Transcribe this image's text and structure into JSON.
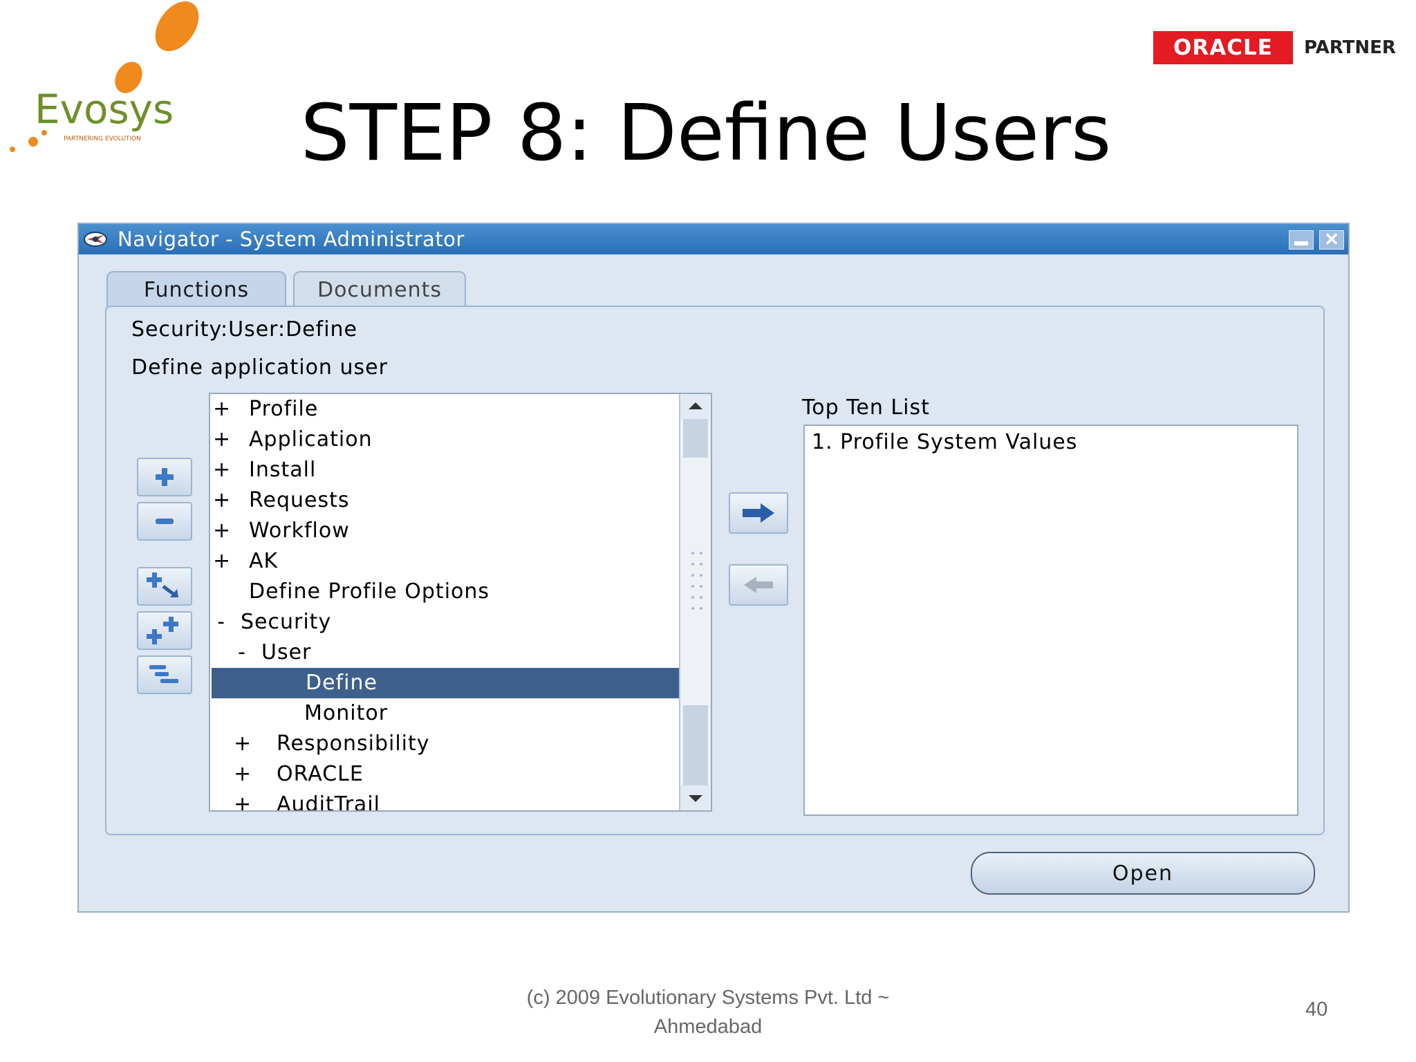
{
  "slide": {
    "title": "STEP 8: Define Users",
    "footer_line1": "(c) 2009 Evolutionary Systems Pvt. Ltd ~",
    "footer_line2": "Ahmedabad",
    "page_number": "40"
  },
  "logos": {
    "evosys_text": "Evosys",
    "evosys_tagline": "PARTNERING EVOLUTION",
    "oracle_text": "ORACLE",
    "partner_text": "PARTNER"
  },
  "window": {
    "title": "Navigator - System Administrator",
    "tabs": [
      {
        "label": "Functions",
        "active": true
      },
      {
        "label": "Documents",
        "active": false
      }
    ],
    "path_label": "Security:User:Define",
    "description": "Define application user",
    "tree_items": [
      {
        "marker": "+",
        "label": "Profile",
        "level": 0
      },
      {
        "marker": "+",
        "label": "Application",
        "level": 0
      },
      {
        "marker": "+",
        "label": "Install",
        "level": 0
      },
      {
        "marker": "+",
        "label": "Requests",
        "level": 0
      },
      {
        "marker": "+",
        "label": "Workflow",
        "level": 0
      },
      {
        "marker": "+",
        "label": "AK",
        "level": 0
      },
      {
        "marker": "",
        "label": "Define Profile Options",
        "level": 0
      },
      {
        "marker": "-",
        "label": "Security",
        "level": 0
      },
      {
        "marker": "-",
        "label": "User",
        "level": 1
      },
      {
        "marker": "",
        "label": "Define",
        "level": 2,
        "selected": true
      },
      {
        "marker": "",
        "label": "Monitor",
        "level": 2
      },
      {
        "marker": "+",
        "label": "Responsibility",
        "level": 1
      },
      {
        "marker": "+",
        "label": "ORACLE",
        "level": 1
      },
      {
        "marker": "+",
        "label": "AuditTrail",
        "level": 1
      }
    ],
    "top_ten_label": "Top Ten List",
    "top_ten_items": [
      "1. Profile System Values"
    ],
    "open_button": "Open"
  },
  "icons": {
    "expand": "plus-icon",
    "collapse": "minus-icon",
    "expand_branch": "expand-branch-icon",
    "expand_all": "expand-all-icon",
    "collapse_all": "collapse-all-icon",
    "add_to_list": "arrow-right-icon",
    "remove_from_list": "arrow-left-icon"
  },
  "colors": {
    "titlebar": "#2a6fb7",
    "selection": "#3f5f8c",
    "oracle_red": "#e31b23",
    "evosys_orange": "#f08a1c",
    "evosys_green": "#6e8f2a"
  }
}
